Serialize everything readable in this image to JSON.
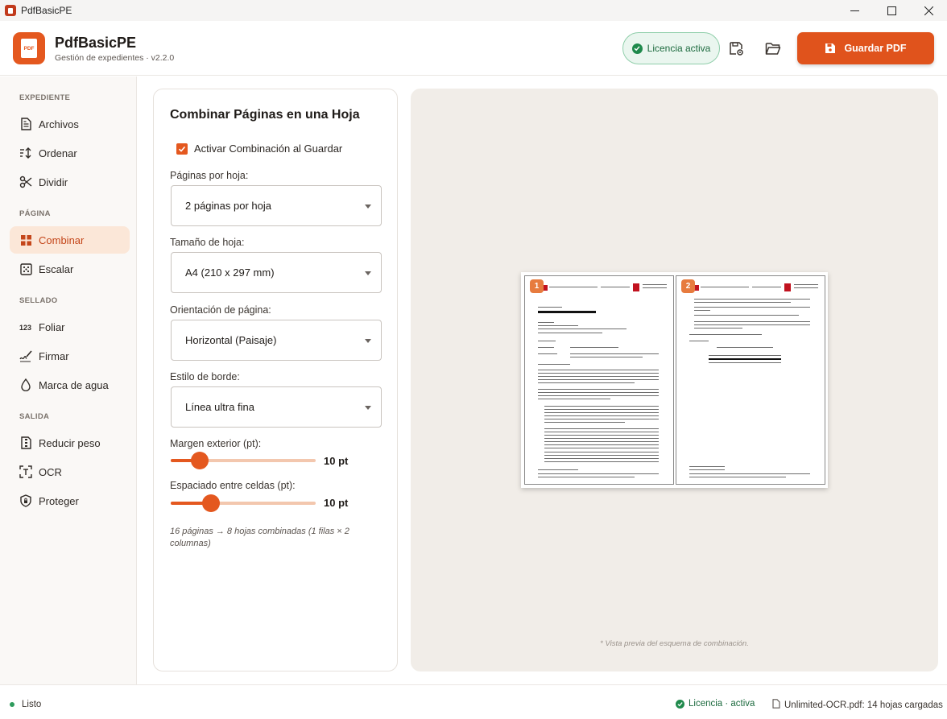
{
  "window": {
    "title": "PdfBasicPE"
  },
  "header": {
    "logo_text": "PDF",
    "app_name": "PdfBasicPE",
    "subtitle": "Gestión de expedientes · v2.2.0",
    "license_label": "Licencia activa",
    "save_label": "Guardar PDF",
    "icons": [
      "save-settings-icon",
      "folder-open-icon"
    ]
  },
  "sidebar": {
    "sections": [
      {
        "label": "EXPEDIENTE",
        "items": [
          {
            "label": "Archivos",
            "icon": "file-icon"
          },
          {
            "label": "Ordenar",
            "icon": "sort-icon"
          },
          {
            "label": "Dividir",
            "icon": "scissors-icon"
          }
        ]
      },
      {
        "label": "PÁGINA",
        "items": [
          {
            "label": "Combinar",
            "icon": "grid-icon",
            "active": true
          },
          {
            "label": "Escalar",
            "icon": "scale-icon"
          }
        ]
      },
      {
        "label": "SELLADO",
        "items": [
          {
            "label": "Foliar",
            "icon": "123-icon"
          },
          {
            "label": "Firmar",
            "icon": "signature-icon"
          },
          {
            "label": "Marca de agua",
            "icon": "drop-icon"
          }
        ]
      },
      {
        "label": "SALIDA",
        "items": [
          {
            "label": "Reducir peso",
            "icon": "compress-icon"
          },
          {
            "label": "OCR",
            "icon": "ocr-icon"
          },
          {
            "label": "Proteger",
            "icon": "shield-icon"
          }
        ]
      }
    ]
  },
  "panel": {
    "title": "Combinar Páginas en una Hoja",
    "enable_label": "Activar Combinación al Guardar",
    "enable_checked": true,
    "pages_per_sheet": {
      "label": "Páginas por hoja:",
      "value": "2 páginas por hoja"
    },
    "sheet_size": {
      "label": "Tamaño de hoja:",
      "value": "A4 (210 x 297 mm)"
    },
    "orientation": {
      "label": "Orientación de página:",
      "value": "Horizontal (Paisaje)"
    },
    "border_style": {
      "label": "Estilo de borde:",
      "value": "Línea ultra fina"
    },
    "margin": {
      "label": "Margen exterior (pt):",
      "value": "10 pt",
      "level": 0.2
    },
    "spacing": {
      "label": "Espaciado entre celdas (pt):",
      "value": "10 pt",
      "level": 0.28
    },
    "summary": "16 páginas → 8 hojas combinadas (1 filas × 2 columnas)"
  },
  "preview": {
    "page_badges": [
      "1",
      "2"
    ],
    "caption": "* Vista previa del esquema de combinación."
  },
  "status": {
    "state": "Listo",
    "license": "Licencia · activa",
    "file": "Unlimited-OCR.pdf: 14 hojas cargadas"
  },
  "colors": {
    "accent": "#e4581f",
    "active_bg": "#fbe7d8",
    "success": "#1f8a4c"
  }
}
